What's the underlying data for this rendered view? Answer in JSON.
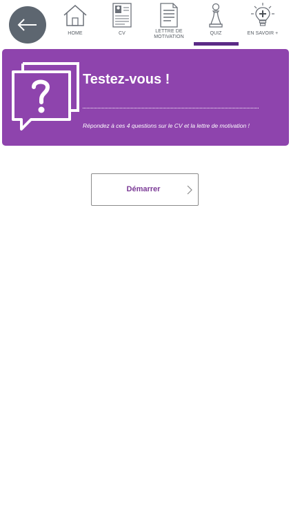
{
  "header": {
    "back_icon": "arrow-left-icon",
    "nav_items": [
      {
        "label": "HOME",
        "icon": "home-icon"
      },
      {
        "label": "CV",
        "icon": "cv-document-icon"
      },
      {
        "label": "LETTRE DE\nMOTIVATION",
        "icon": "letter-document-icon"
      },
      {
        "label": "QUIZ",
        "icon": "chess-pawn-icon",
        "active": true
      },
      {
        "label": "EN SAVOIR +",
        "icon": "lightbulb-plus-icon"
      }
    ]
  },
  "banner": {
    "icon": "question-bubble-icon",
    "title": "Testez-vous !",
    "subtitle": "Répondez à ces 4 questions sur le CV et la lettre de motivation !"
  },
  "start": {
    "label": "Démarrer",
    "icon": "chevron-right-icon"
  },
  "colors": {
    "accent": "#8e44ad",
    "active_bar": "#5b2a86",
    "back_button": "#5d6670",
    "button_text": "#7b3a96"
  }
}
